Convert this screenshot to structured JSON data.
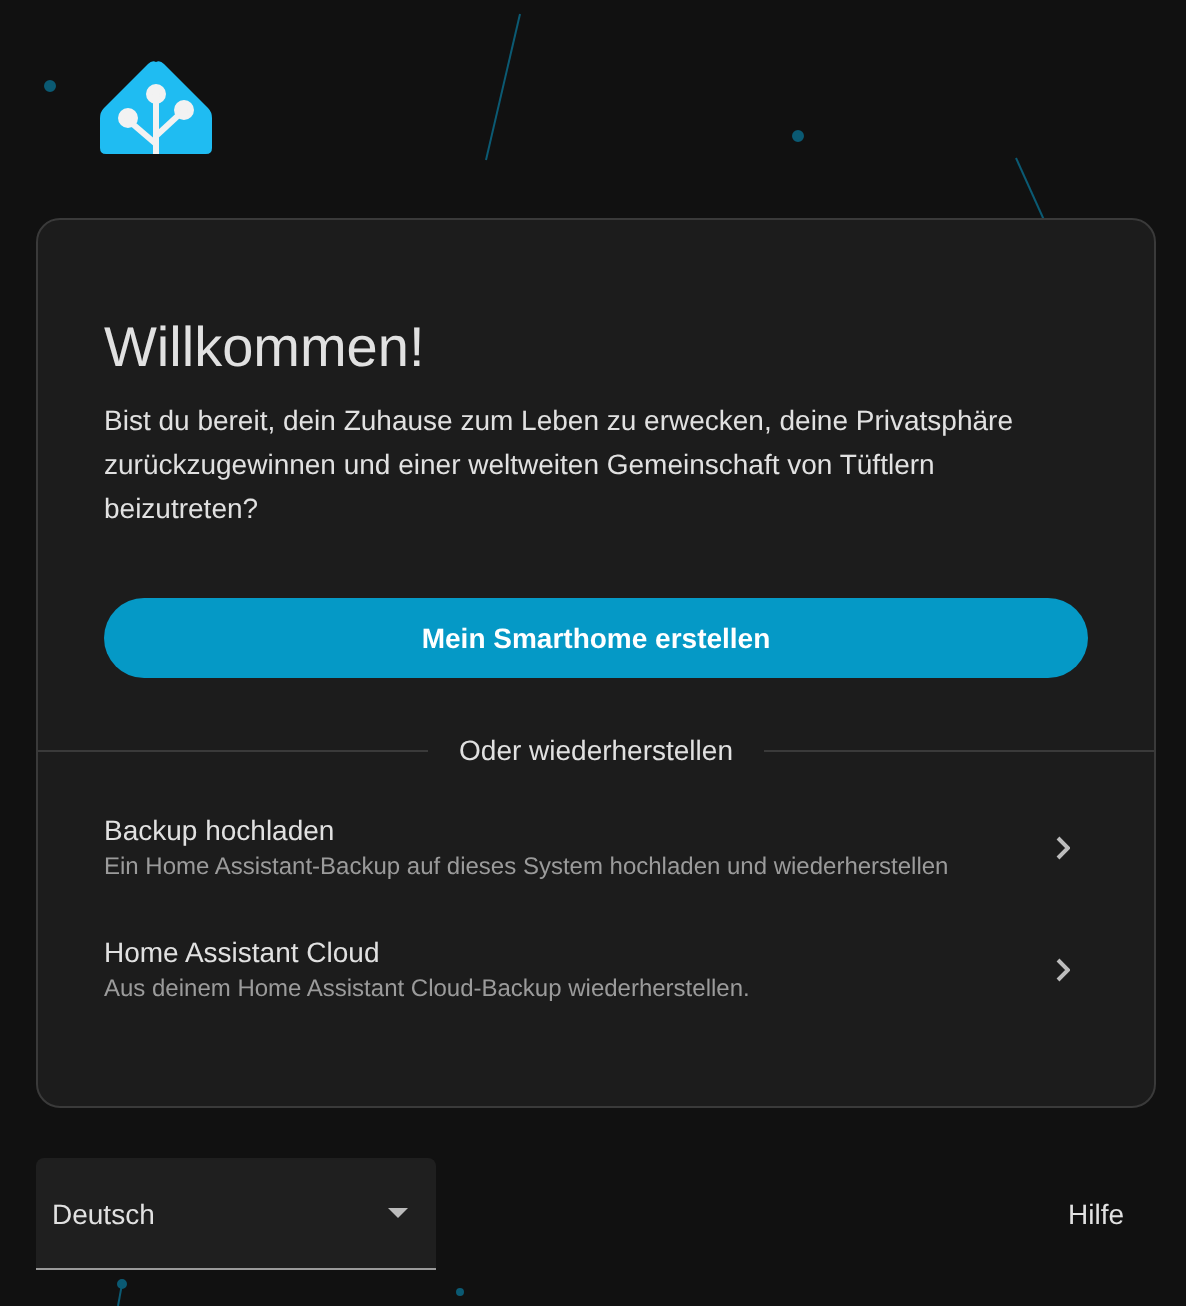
{
  "card": {
    "title": "Willkommen!",
    "intro": "Bist du bereit, dein Zuhause zum Leben zu erwecken, deine Privatsphäre zurückzugewinnen und einer weltweiten Gemeinschaft von Tüftlern beizutreten?",
    "primary_button": "Mein Smarthome erstellen",
    "divider_label": "Oder wiederherstellen",
    "restore_options": [
      {
        "title": "Backup hochladen",
        "description": "Ein Home Assistant-Backup auf dieses System hochladen und wiederherstellen"
      },
      {
        "title": "Home Assistant Cloud",
        "description": "Aus deinem Home Assistant Cloud-Backup wiederherstellen."
      }
    ]
  },
  "footer": {
    "language_select": {
      "value": "Deutsch"
    },
    "help_link": "Hilfe"
  }
}
